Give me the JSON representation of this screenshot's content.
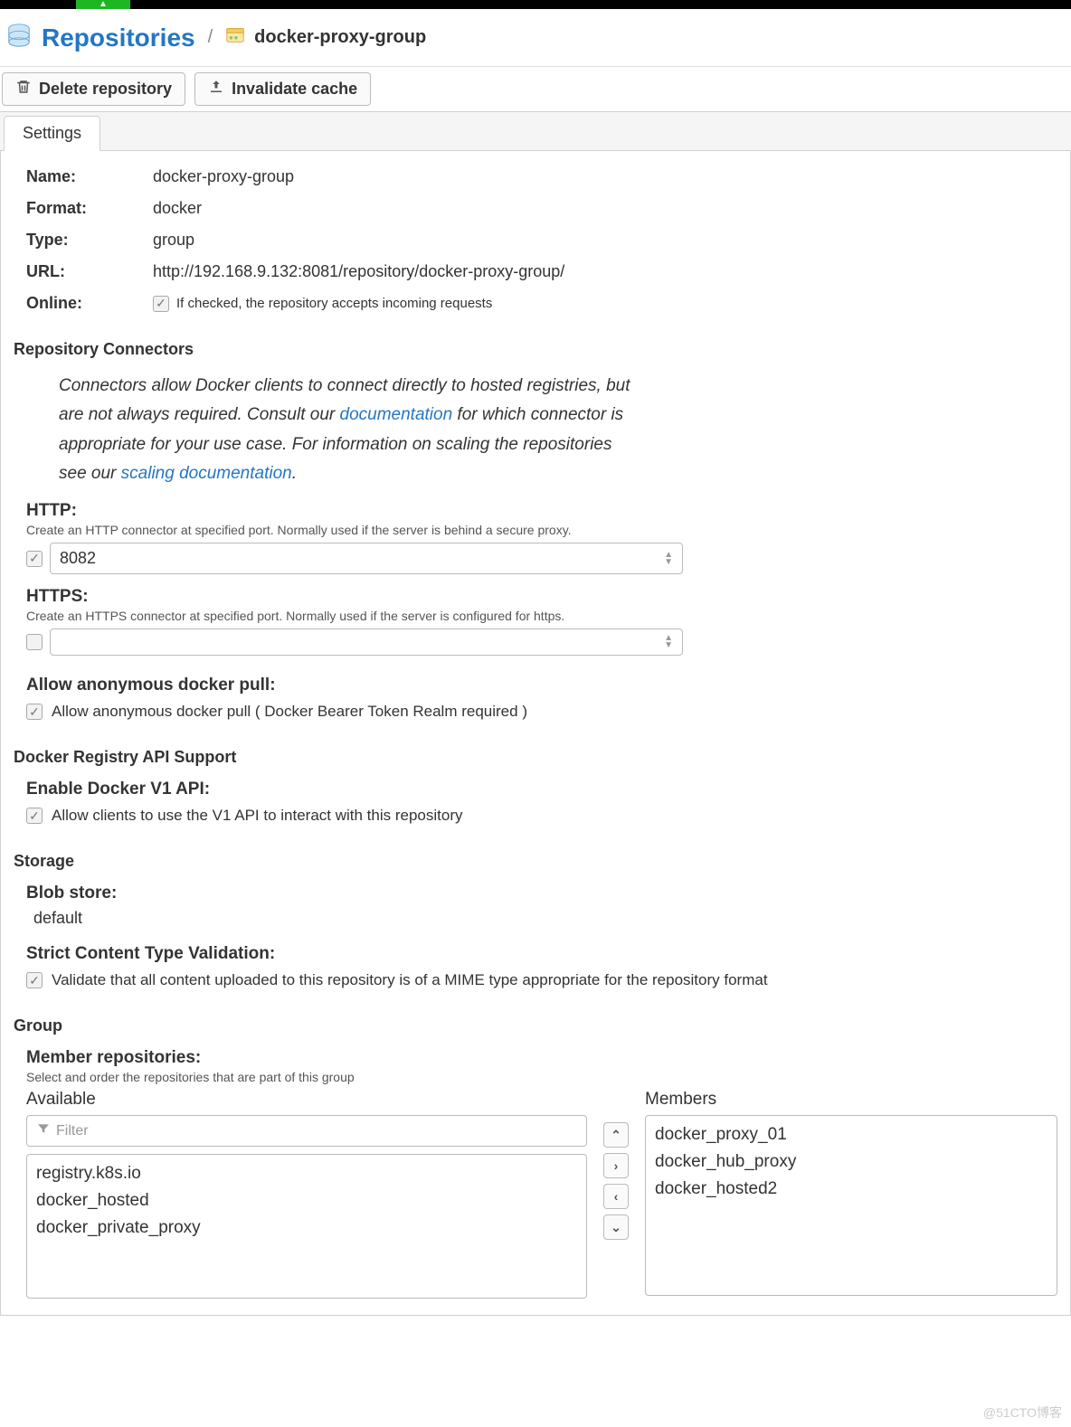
{
  "breadcrumb": {
    "root": "Repositories",
    "current": "docker-proxy-group"
  },
  "toolbar": {
    "delete_label": "Delete repository",
    "invalidate_label": "Invalidate cache"
  },
  "tabs": {
    "settings": "Settings"
  },
  "fields": {
    "name_label": "Name:",
    "name_value": "docker-proxy-group",
    "format_label": "Format:",
    "format_value": "docker",
    "type_label": "Type:",
    "type_value": "group",
    "url_label": "URL:",
    "url_value": "http://192.168.9.132:8081/repository/docker-proxy-group/",
    "online_label": "Online:",
    "online_help": "If checked, the repository accepts incoming requests"
  },
  "connectors": {
    "heading": "Repository Connectors",
    "desc_pre": "Connectors allow Docker clients to connect directly to hosted registries, but are not always required. Consult our ",
    "doc_link": "documentation",
    "desc_mid": " for which connector is appropriate for your use case. For information on scaling the repositories see our ",
    "scale_link": "scaling documentation",
    "desc_post": ".",
    "http_label": "HTTP:",
    "http_help": "Create an HTTP connector at specified port. Normally used if the server is behind a secure proxy.",
    "http_value": "8082",
    "https_label": "HTTPS:",
    "https_help": "Create an HTTPS connector at specified port. Normally used if the server is configured for https.",
    "https_value": "",
    "anon_label": "Allow anonymous docker pull:",
    "anon_text": "Allow anonymous docker pull ( Docker Bearer Token Realm required )"
  },
  "api": {
    "heading": "Docker Registry API Support",
    "v1_label": "Enable Docker V1 API:",
    "v1_text": "Allow clients to use the V1 API to interact with this repository"
  },
  "storage": {
    "heading": "Storage",
    "blob_label": "Blob store:",
    "blob_value": "default",
    "strict_label": "Strict Content Type Validation:",
    "strict_text": "Validate that all content uploaded to this repository is of a MIME type appropriate for the repository format"
  },
  "group": {
    "heading": "Group",
    "member_label": "Member repositories:",
    "member_help": "Select and order the repositories that are part of this group",
    "available_h": "Available",
    "members_h": "Members",
    "filter_placeholder": "Filter",
    "available": [
      "registry.k8s.io",
      "docker_hosted",
      "docker_private_proxy"
    ],
    "members": [
      "docker_proxy_01",
      "docker_hub_proxy",
      "docker_hosted2"
    ]
  },
  "watermark": "@51CTO博客"
}
